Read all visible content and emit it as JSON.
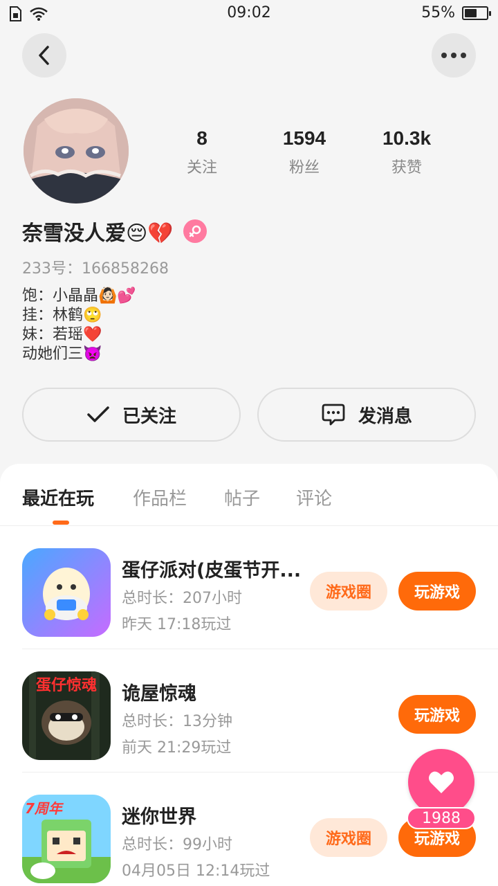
{
  "status_bar": {
    "time": "09:02",
    "battery_percent": "55%",
    "battery_level": 0.55
  },
  "profile": {
    "nickname": "奈雪没人爱😔💔",
    "user_id": "233号：166858268",
    "bio": [
      "饱：小晶晶🙆🏻💕",
      "挂：林鹤🙄",
      "妹：若瑶❤️",
      "动她们三👿"
    ],
    "stats": [
      {
        "value": "8",
        "label": "关注"
      },
      {
        "value": "1594",
        "label": "粉丝"
      },
      {
        "value": "10.3k",
        "label": "获赞"
      }
    ]
  },
  "actions": {
    "follow_label": "已关注",
    "message_label": "发消息"
  },
  "tabs": [
    "最近在玩",
    "作品栏",
    "帖子",
    "评论"
  ],
  "games": [
    {
      "title": "蛋仔派对(皮蛋节开...",
      "duration": "总时长：207小时",
      "last_played": "昨天 17:18玩过",
      "circle_label": "游戏圈",
      "play_label": "玩游戏"
    },
    {
      "title": "诡屋惊魂",
      "duration": "总时长：13分钟",
      "last_played": "前天 21:29玩过",
      "play_label": "玩游戏",
      "icon_text": "蛋仔惊魂"
    },
    {
      "title": "迷你世界",
      "duration": "总时长：99小时",
      "last_played": "04月05日 12:14玩过",
      "circle_label": "游戏圈",
      "play_label": "玩游戏",
      "icon_text": "7周年"
    }
  ],
  "like_count": "1988",
  "colors": {
    "accent": "#ff6a0a",
    "like": "#ff4d8a",
    "circle_bg": "#ffe8d8"
  },
  "icons": [
    "wifi-icon",
    "back-icon",
    "more-icon",
    "female-icon",
    "check-icon",
    "message-icon",
    "heart-icon"
  ]
}
